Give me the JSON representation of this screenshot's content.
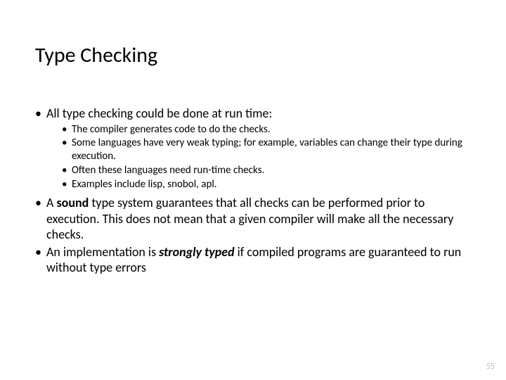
{
  "title": "Type Checking",
  "bullets": {
    "b1": "All type checking could be done at run time:",
    "b1_sub": {
      "s1": "The compiler generates code to do the checks.",
      "s2": "Some languages have very weak typing; for example, variables can change their type during execution.",
      "s3": "Often these languages need run-time checks.",
      "s4": "Examples include lisp, snobol, apl."
    },
    "b2_pre": "A ",
    "b2_bold": "sound",
    "b2_post": " type system guarantees that all checks can be performed prior to execution. This does not mean that a given compiler will make all the necessary checks.",
    "b3_pre": "An implementation is ",
    "b3_bi": "strongly typed",
    "b3_post": " if compiled programs are guaranteed to run without type errors"
  },
  "page_number": "55"
}
